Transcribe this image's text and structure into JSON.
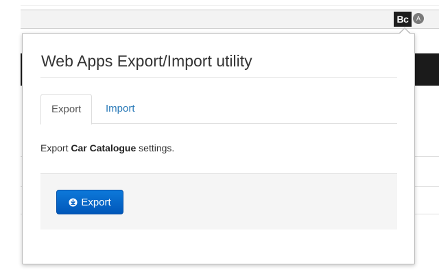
{
  "browser": {
    "logo_text": "Bc",
    "extension_badge": "A"
  },
  "popup": {
    "title": "Web Apps Export/Import utility",
    "tabs": [
      {
        "label": "Export",
        "active": true
      },
      {
        "label": "Import",
        "active": false
      }
    ],
    "description": {
      "prefix": "Export ",
      "app_name": "Car Catalogue",
      "suffix": " settings."
    },
    "export_button": {
      "label": "Export",
      "icon": "download-circle-icon"
    }
  },
  "colors": {
    "primary_button": "#0a6fd1",
    "link": "#2a7ab8",
    "title_text": "#333333"
  }
}
